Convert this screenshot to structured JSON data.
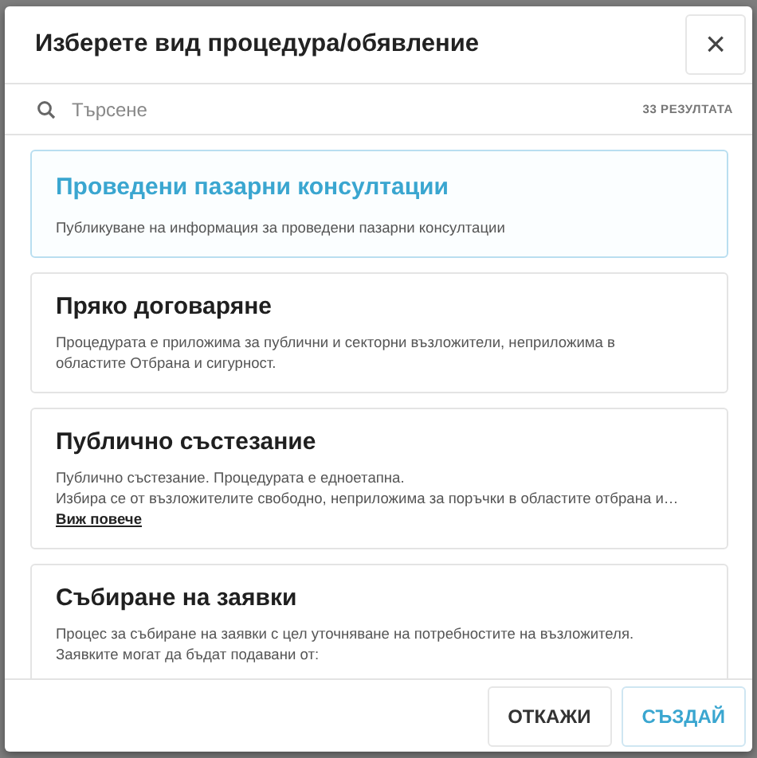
{
  "dialog": {
    "title": "Изберете вид процедура/обявление",
    "close": "×"
  },
  "search": {
    "placeholder": "Търсене",
    "count": "33 РЕЗУЛТАТА"
  },
  "procedures": [
    {
      "title": "Проведени пазарни консултации",
      "description": [
        "Публикуване на информация за проведени пазарни консултации"
      ],
      "selected": true
    },
    {
      "title": "Пряко договаряне",
      "description": [
        "Процедурата е приложима за публични и секторни възложители,  неприложима в областите Отбрана и сигурност."
      ],
      "selected": false
    },
    {
      "title": "Публично състезание",
      "description": [
        "Публично състезание.  Процедурата е едноетапна.",
        "Избира се от възложителите свободно, неприложима за поръчки в областите отбрана и…"
      ],
      "more": "Виж повече",
      "selected": false
    },
    {
      "title": "Събиране на заявки",
      "description": [
        "Процес за събиране на заявки с цел уточняване на потребностите на възложителя.",
        "Заявките могат да бъдат подавани от:"
      ],
      "selected": false
    }
  ],
  "buttons": [
    {
      "label": "ОТКАЖИ",
      "kind": "secondary"
    },
    {
      "label": "СЪЗДАЙ",
      "kind": "primary"
    }
  ]
}
